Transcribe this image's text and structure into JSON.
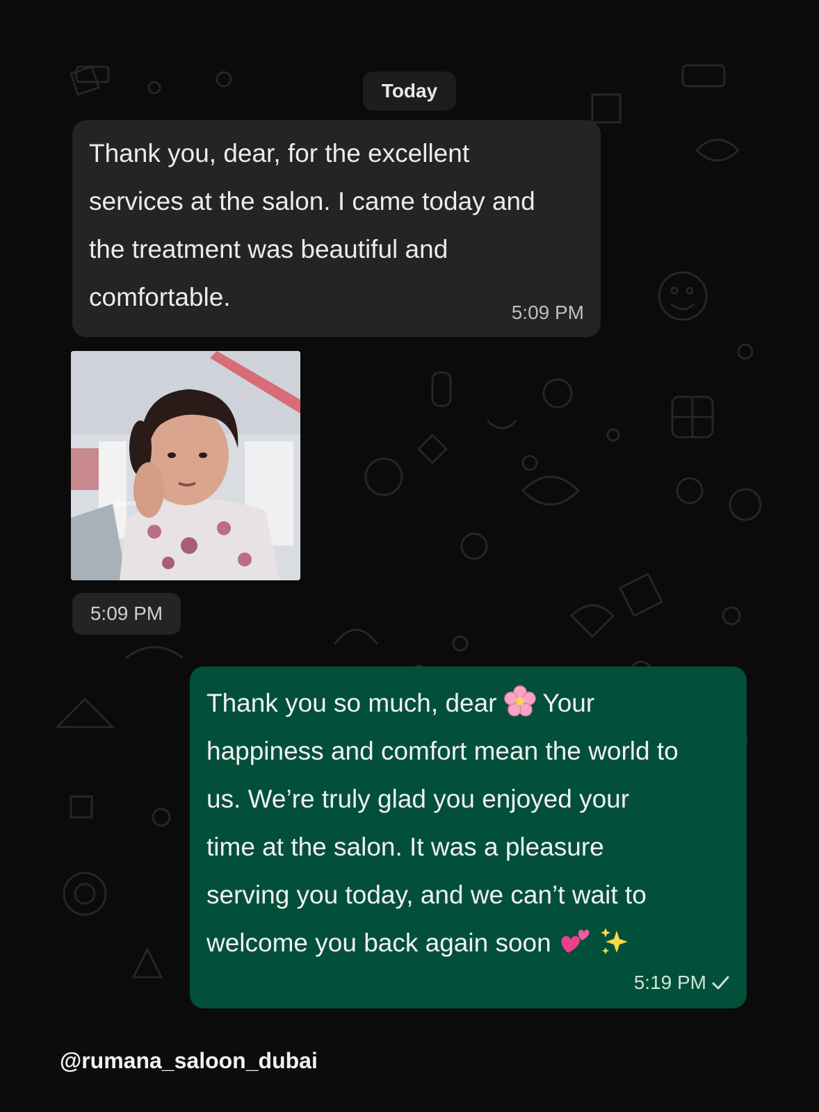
{
  "chat": {
    "date_label": "Today",
    "messages": [
      {
        "direction": "incoming",
        "lines": [
          "Thank you, dear, for the excellent",
          "services at the salon. I came today and",
          "the treatment was beautiful and",
          "comfortable."
        ],
        "time": "5:09 PM"
      },
      {
        "direction": "incoming",
        "media": "girl-gesture-photo",
        "time": "5:09 PM"
      },
      {
        "direction": "outgoing",
        "line1_a": "Thank you so much, dear",
        "line1_b": "Your",
        "lines": [
          "happiness and comfort mean the world to",
          "us. We’re truly glad you enjoyed your",
          "time at the salon. It was a pleasure",
          "serving you today, and we can’t wait to"
        ],
        "last_line": "welcome you back again soon",
        "emojis": [
          "cherry-blossom",
          "two-hearts",
          "sparkles"
        ],
        "time": "5:19 PM",
        "status_icon": "check-icon"
      }
    ]
  },
  "footer": {
    "handle": "@rumana_saloon_dubai"
  },
  "colors": {
    "incoming_bubble": "#242424",
    "outgoing_bubble": "#02503a",
    "background": "#0b0b0b"
  }
}
